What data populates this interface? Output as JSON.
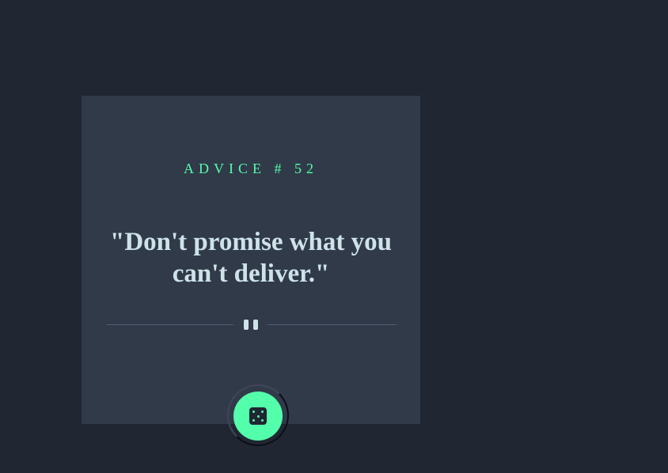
{
  "card": {
    "advice_label": "ADVICE # 52",
    "quote": "\"Don't promise what you can't deliver.\""
  },
  "icons": {
    "divider": "pause-icon",
    "button": "dice-icon"
  },
  "colors": {
    "background": "#202632",
    "card": "#313a49",
    "accent": "#53ffaa",
    "quote_text": "#cee3e9",
    "divider": "#4f5d74"
  }
}
